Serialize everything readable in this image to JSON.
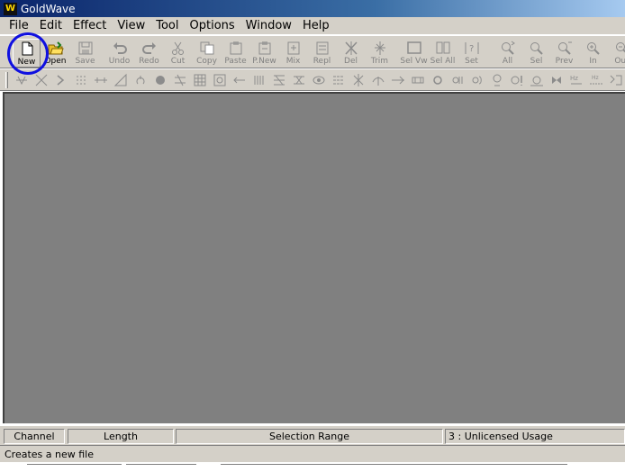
{
  "window": {
    "title": "GoldWave",
    "icon": "goldwave-logo-icon",
    "icon_glyph": "W"
  },
  "menu": [
    "File",
    "Edit",
    "Effect",
    "View",
    "Tool",
    "Options",
    "Window",
    "Help"
  ],
  "toolbar": [
    {
      "label": "New",
      "icon": "new-file-icon",
      "enabled": true
    },
    {
      "label": "Open",
      "icon": "open-folder-icon",
      "enabled": true
    },
    {
      "label": "Save",
      "icon": "save-icon",
      "enabled": false
    },
    {
      "label": "Undo",
      "icon": "undo-icon",
      "enabled": false
    },
    {
      "label": "Redo",
      "icon": "redo-icon",
      "enabled": false
    },
    {
      "label": "Cut",
      "icon": "cut-icon",
      "enabled": false
    },
    {
      "label": "Copy",
      "icon": "copy-icon",
      "enabled": false
    },
    {
      "label": "Paste",
      "icon": "paste-icon",
      "enabled": false
    },
    {
      "label": "P.New",
      "icon": "paste-new-icon",
      "enabled": false
    },
    {
      "label": "Mix",
      "icon": "mix-icon",
      "enabled": false
    },
    {
      "label": "Repl",
      "icon": "replace-icon",
      "enabled": false
    },
    {
      "label": "Del",
      "icon": "delete-icon",
      "enabled": false
    },
    {
      "label": "Trim",
      "icon": "trim-icon",
      "enabled": false
    },
    {
      "label": "Sel Vw",
      "icon": "select-view-icon",
      "enabled": false
    },
    {
      "label": "Sel All",
      "icon": "select-all-icon",
      "enabled": false
    },
    {
      "label": "Set",
      "icon": "set-selection-icon",
      "enabled": false
    },
    {
      "label": "All",
      "icon": "zoom-all-icon",
      "enabled": false
    },
    {
      "label": "Sel",
      "icon": "zoom-selection-icon",
      "enabled": false
    },
    {
      "label": "Prev",
      "icon": "zoom-previous-icon",
      "enabled": false
    },
    {
      "label": "In",
      "icon": "zoom-in-icon",
      "enabled": false
    },
    {
      "label": "Out",
      "icon": "zoom-out-icon",
      "enabled": false
    }
  ],
  "effects_toolbar": [
    "doppler-icon",
    "dynamics-icon",
    "echo-icon",
    "expand-icon",
    "fade-icon",
    "fade-out-icon",
    "filter-icon",
    "flange-icon",
    "invert-icon",
    "equalizer-icon",
    "mechanize-icon",
    "offset-icon",
    "pan-icon",
    "pitch-icon",
    "playback-rate-icon",
    "resample-icon",
    "reverse-icon",
    "reverb-icon",
    "silence-icon",
    "time-warp-icon",
    "volume-icon",
    "noise-reduction-icon",
    "pop-click-icon",
    "compressor-icon",
    "channel-mixer-icon",
    "auto-trim-icon",
    "maximize-volume-icon",
    "match-volume-icon",
    "stereo-center-icon",
    "bandpass-icon",
    "lowpass-icon",
    "spectrum-icon"
  ],
  "status": {
    "channel": "Channel",
    "length": "Length",
    "selection_range": "Selection Range",
    "license": "3 : Unlicensed Usage"
  },
  "hint": "Creates a new file",
  "annotation": {
    "highlight_color": "#1010e0",
    "highlighted_button": "New"
  },
  "colors": {
    "workspace": "#808080",
    "chrome": "#d4d0c8",
    "title_start": "#0a246a",
    "title_end": "#a6caf0"
  }
}
